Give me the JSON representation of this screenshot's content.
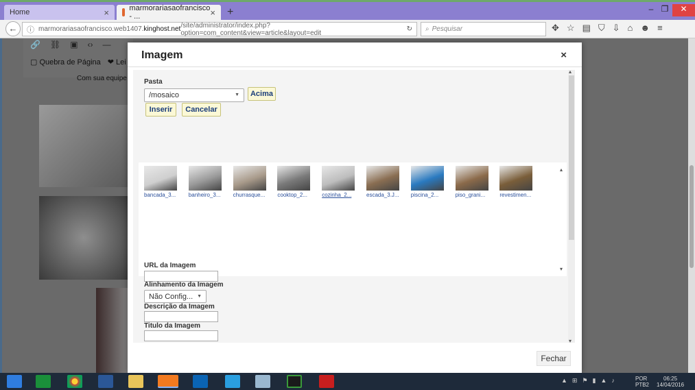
{
  "browser": {
    "tabs": [
      {
        "label": "Home"
      },
      {
        "label": "marmorariasaofrancisco - ..."
      }
    ],
    "url_prefix": "marmorariasaofrancisco.web1407.",
    "url_host": "kinghost.net",
    "url_path": "/site/administrator/index.php?option=com_content&view=article&layout=edit",
    "search_placeholder": "Pesquisar"
  },
  "editor": {
    "toolbar_row2": [
      "Quebra de Página",
      "Lei"
    ],
    "page_text": "Com sua equipe e"
  },
  "modal": {
    "title": "Imagem",
    "close_glyph": "×",
    "folder_label": "Pasta",
    "folder_value": "/mosaico",
    "up_button": "Acima",
    "insert_button": "Inserir",
    "cancel_button": "Cancelar",
    "images": [
      {
        "caption": "bancada_3...",
        "color": "#cfcfcf"
      },
      {
        "caption": "banheiro_3...",
        "color": "#9a9a9a"
      },
      {
        "caption": "churrasque...",
        "color": "#a89a8a"
      },
      {
        "caption": "cooktop_2...",
        "color": "#7a7a7a"
      },
      {
        "caption": "cozinha_2...",
        "color": "#bdbdbd"
      },
      {
        "caption": "escada_3.J...",
        "color": "#8a6e52"
      },
      {
        "caption": "piscina_2...",
        "color": "#2a7ac0"
      },
      {
        "caption": "piso_grani...",
        "color": "#8b6a4a"
      },
      {
        "caption": "revestimen...",
        "color": "#7a5e3a"
      }
    ],
    "fields": {
      "url_label": "URL da Imagem",
      "align_label": "Alinhamento da Imagem",
      "align_value": "Não Config...",
      "desc_label": "Descrição da Imagem",
      "title_label": "Titulo da Imagem"
    },
    "close_button": "Fechar"
  },
  "taskbar": {
    "lang_top": "POR",
    "lang_bottom": "PTB2",
    "time": "06:25",
    "date": "14/04/2016"
  }
}
